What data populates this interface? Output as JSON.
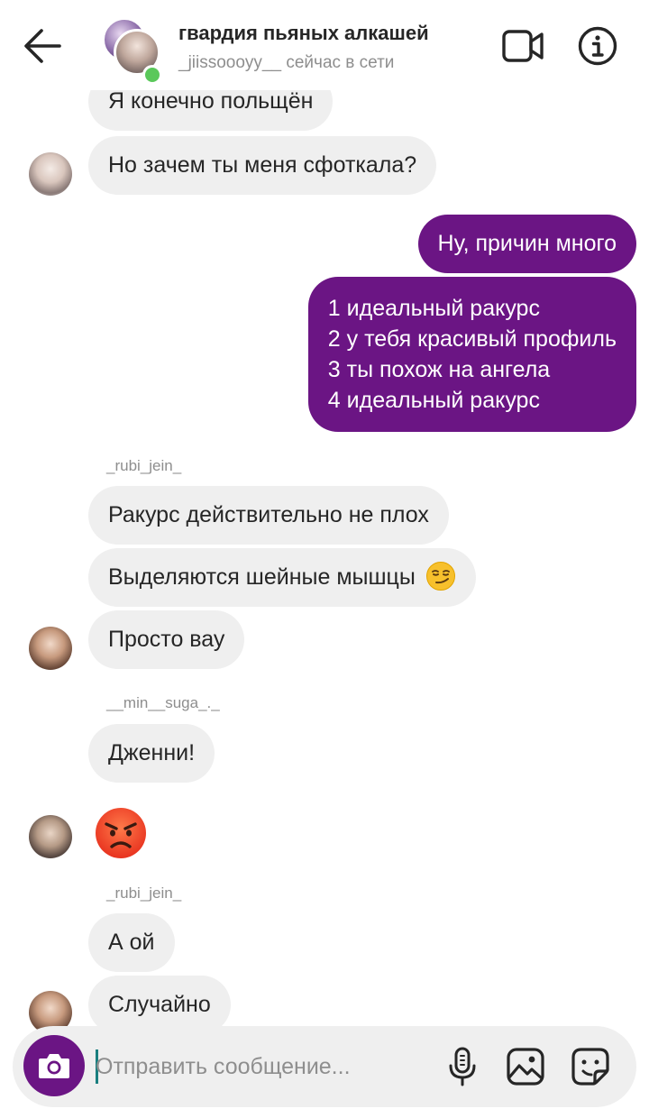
{
  "header": {
    "title": "гвардия пьяных алкашей",
    "status_user": "_jiissoooyy__",
    "status_text": "сейчас в сети"
  },
  "colors": {
    "accent": "#6b1584",
    "incoming_bubble": "#efefef",
    "online": "#5ac85a",
    "secondary_text": "#8e8e8e"
  },
  "messages": [
    {
      "direction": "in",
      "text": "Я конечно польщён"
    },
    {
      "direction": "in",
      "text": "Но зачем ты меня сфоткала?"
    },
    {
      "direction": "out",
      "text": "Ну, причин много"
    },
    {
      "direction": "out",
      "lines": [
        "1 идеальный ракурс",
        "2 у тебя красивый профиль",
        "3 ты похож на ангела",
        "4 идеальный ракурс"
      ]
    },
    {
      "direction": "in",
      "sender": "_rubi_jein_",
      "text": "Ракурс действительно не плох"
    },
    {
      "direction": "in",
      "text": "Выделяются шейные мышцы",
      "emoji": "smirk-emoji"
    },
    {
      "direction": "in",
      "text": "Просто вау"
    },
    {
      "direction": "in",
      "sender": "__min__suga_._",
      "text": "Дженни!"
    },
    {
      "direction": "in",
      "emoji": "angry-face-emoji"
    },
    {
      "direction": "in",
      "sender": "_rubi_jein_",
      "text": "А ой"
    },
    {
      "direction": "in",
      "text": "Случайно"
    }
  ],
  "composer": {
    "placeholder": "Отправить сообщение...",
    "icons": [
      "camera-icon",
      "microphone-icon",
      "gallery-icon",
      "sticker-icon"
    ]
  },
  "icons": {
    "back": "arrow-left-icon",
    "video": "video-camera-icon",
    "info": "info-icon"
  }
}
